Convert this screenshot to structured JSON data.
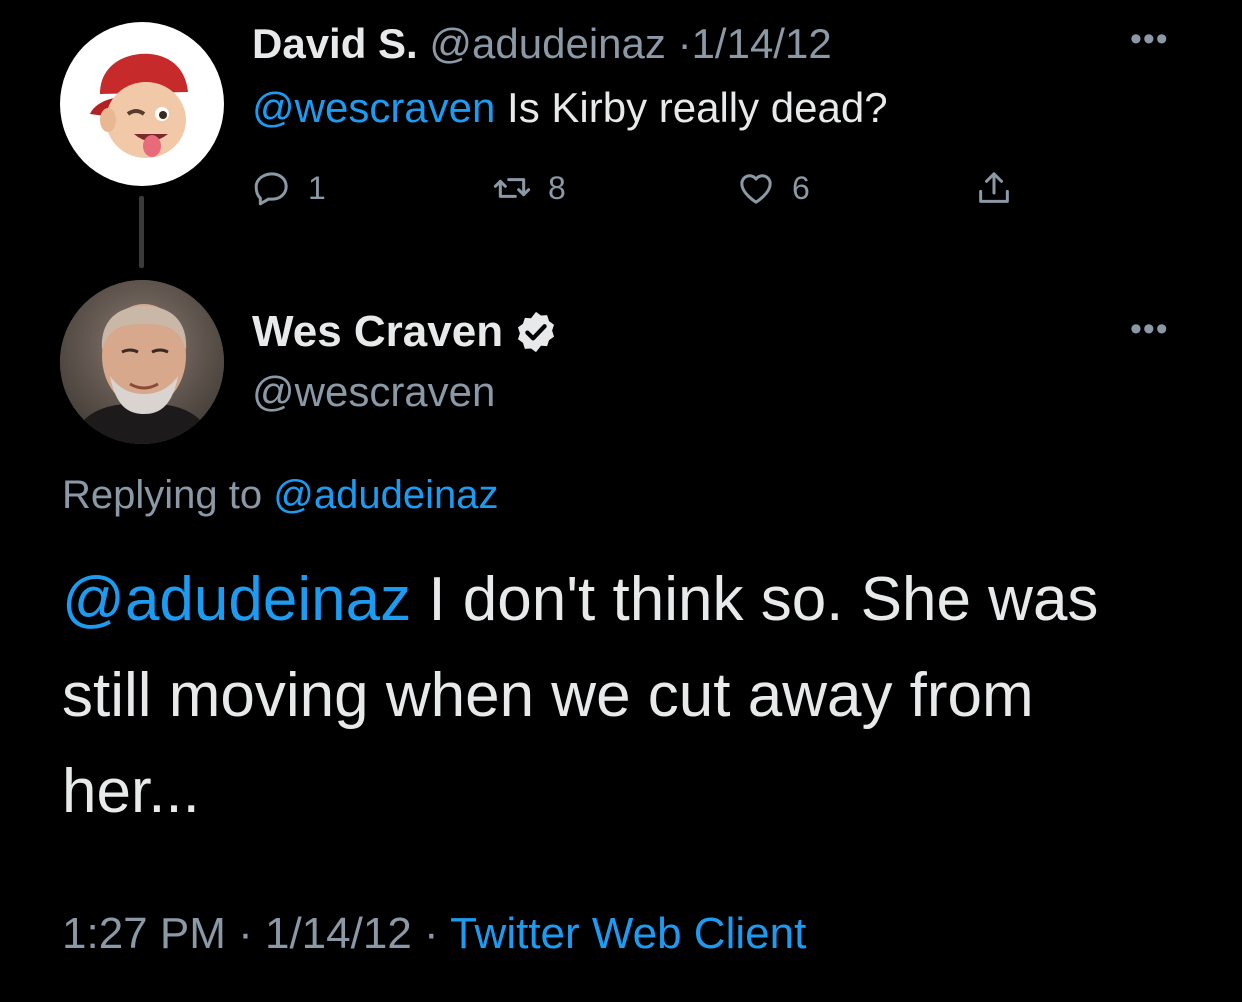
{
  "parent_tweet": {
    "name": "David S.",
    "handle": "@adudeinaz",
    "separator": "·",
    "date": "1/14/12",
    "mention": "@wescraven",
    "text": " Is Kirby really dead?",
    "more": "•••",
    "actions": {
      "reply_count": "1",
      "retweet_count": "8",
      "like_count": "6"
    },
    "icons": [
      "avatar-memoji-icon",
      "reply-icon",
      "retweet-icon",
      "like-icon",
      "share-icon",
      "more-icon"
    ]
  },
  "reply_tweet": {
    "name": "Wes Craven",
    "handle": "@wescraven",
    "more": "•••",
    "replying_label": "Replying to ",
    "replying_handle": "@adudeinaz",
    "mention": "@adudeinaz",
    "text": " I don't think so. She was still moving when we cut away from her...",
    "time": "1:27 PM",
    "separator": " · ",
    "date": "1/14/12",
    "source": "Twitter Web Client"
  },
  "colors": {
    "background": "#000000",
    "link": "#1d9bf0",
    "secondary": "#8b98a5",
    "primary_text": "#e7e9ea"
  }
}
